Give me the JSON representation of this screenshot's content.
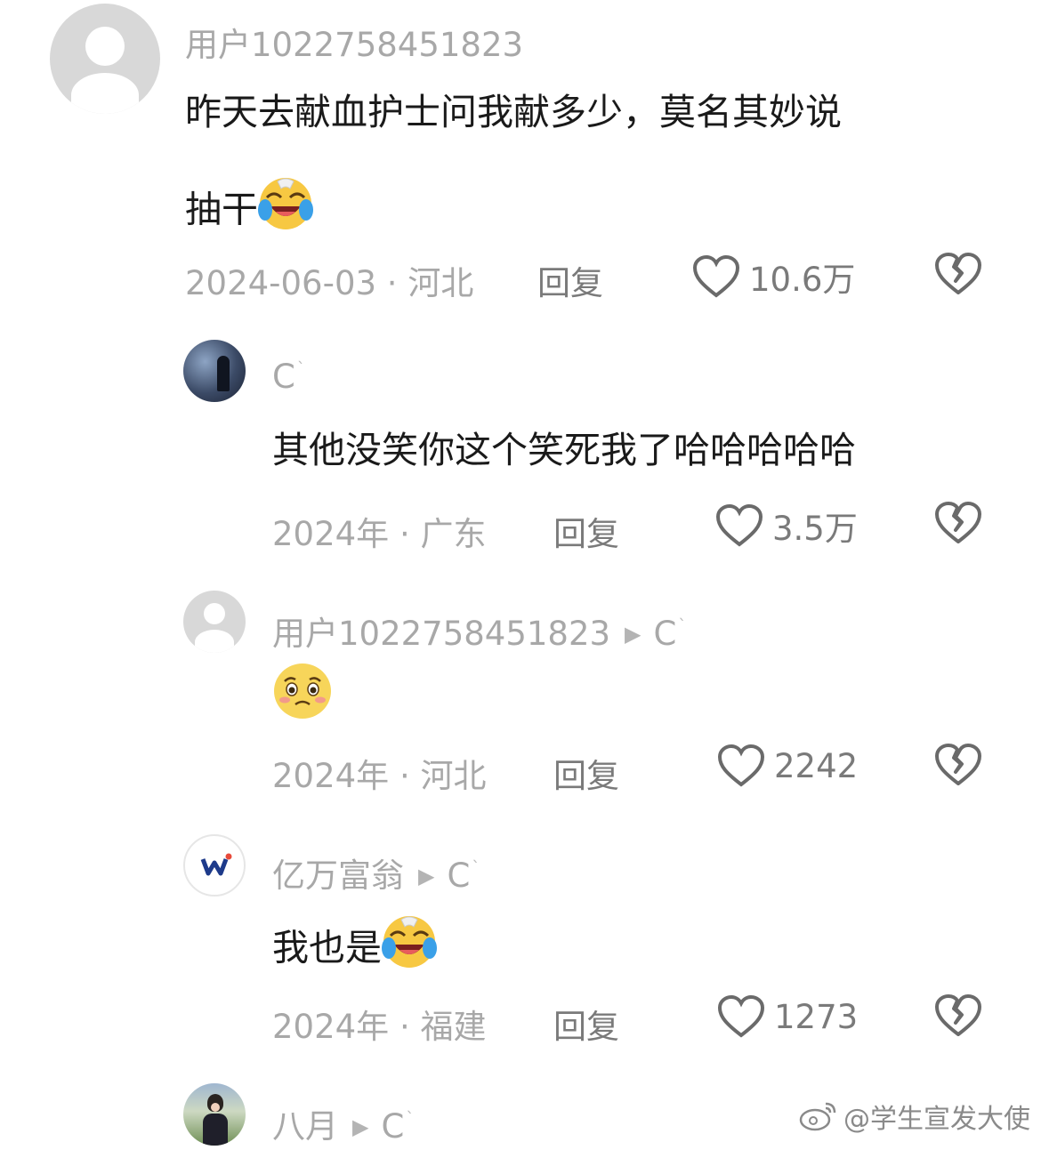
{
  "comments": [
    {
      "username": "用户1022758451823",
      "content_line1": "昨天去献血护士问我献多少，莫名其妙说",
      "content_line2": "抽干",
      "date": "2024-06-03",
      "location": "河北",
      "reply_label": "回复",
      "likes": "10.6万",
      "emoji": "laughing-crying"
    },
    {
      "username": "C",
      "content": "其他没笑你这个笑死我了哈哈哈哈哈",
      "date": "2024年",
      "location": "广东",
      "reply_label": "回复",
      "likes": "3.5万"
    },
    {
      "username": "用户1022758451823",
      "reply_to": "C",
      "date": "2024年",
      "location": "河北",
      "reply_label": "回复",
      "likes": "2242",
      "emoji": "pleading-face"
    },
    {
      "username": "亿万富翁",
      "reply_to": "C",
      "content": "我也是",
      "date": "2024年",
      "location": "福建",
      "reply_label": "回复",
      "likes": "1273",
      "emoji": "laughing-crying"
    },
    {
      "username": "八月",
      "reply_to": "C"
    }
  ],
  "separator": "·",
  "watermark": "@学生宣发大使",
  "colors": {
    "meta_gray": "#a8a8a8",
    "text": "#1a1a1a",
    "icon_gray": "#6a6a6a",
    "emoji_yellow": "#f7c842"
  }
}
